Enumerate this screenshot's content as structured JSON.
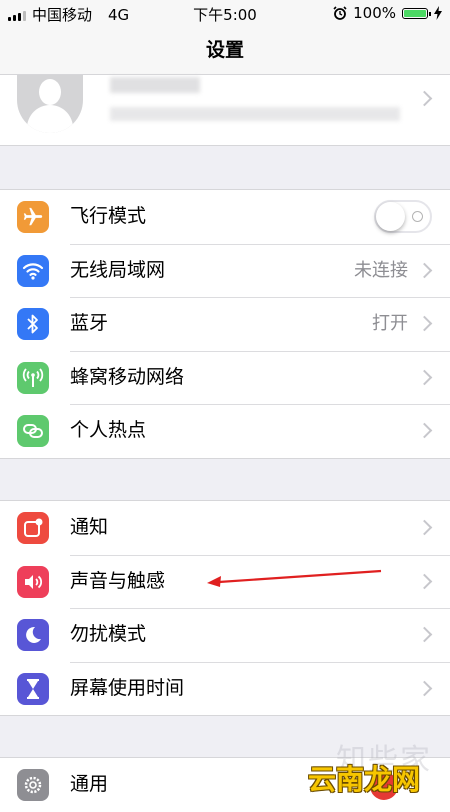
{
  "status": {
    "carrier": "中国移动",
    "network": "4G",
    "time": "下午5:00",
    "battery": "100%",
    "battery_level": 1.0
  },
  "nav": {
    "title": "设置"
  },
  "group1": [
    {
      "label": "飞行模式",
      "icon": "airplane-icon",
      "color": "#f19a37",
      "toggle": false
    },
    {
      "label": "无线局域网",
      "value": "未连接",
      "icon": "wifi-icon",
      "color": "#3478f6"
    },
    {
      "label": "蓝牙",
      "value": "打开",
      "icon": "bluetooth-icon",
      "color": "#3478f6"
    },
    {
      "label": "蜂窝移动网络",
      "icon": "cellular-icon",
      "color": "#5ec96e"
    },
    {
      "label": "个人热点",
      "icon": "hotspot-icon",
      "color": "#5ec96e"
    }
  ],
  "group2": [
    {
      "label": "通知",
      "icon": "notifications-icon",
      "color": "#ee4a3f"
    },
    {
      "label": "声音与触感",
      "icon": "sound-icon",
      "color": "#ee3f5a"
    },
    {
      "label": "勿扰模式",
      "icon": "moon-icon",
      "color": "#5856d6"
    },
    {
      "label": "屏幕使用时间",
      "icon": "hourglass-icon",
      "color": "#5856d6"
    }
  ],
  "group3": [
    {
      "label": "通用",
      "icon": "gear-icon",
      "color": "#8e8e93"
    }
  ],
  "watermarks": {
    "zhi": "知些家",
    "site": "云南龙网"
  }
}
